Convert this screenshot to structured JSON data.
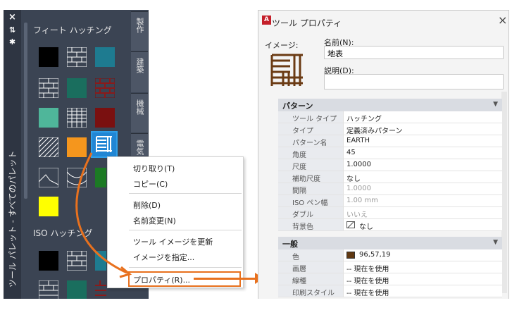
{
  "palette": {
    "close_icon": "×",
    "move_icon": "⇅",
    "settings_icon": "✱",
    "title": "ツール パレット - すべてのパレット",
    "section1": "フィート ハッチング",
    "section2": "ISO ハッチング",
    "tabs": [
      "製作",
      "建築",
      "機械",
      "電気"
    ],
    "swatch_colors": {
      "black": "#000000",
      "teal": "#1e7b90",
      "darkteal": "#1a6e5e",
      "green": "#4fb69a",
      "orange": "#f5961d",
      "maroon": "#7a1010",
      "yellow": "#ffff00",
      "brightgreen": "#1c7a24"
    }
  },
  "menu": {
    "cut": "切り取り(T)",
    "copy": "コピー(C)",
    "delete": "削除(D)",
    "rename": "名前変更(N)",
    "update_image": "ツール イメージを更新",
    "specify_image": "イメージを指定...",
    "properties": "プロパティ(R)..."
  },
  "dialog": {
    "title": "ツール プロパティ",
    "image_label": "イメージ:",
    "name_label": "名前(N):",
    "name_value": "地表",
    "desc_label": "説明(D):",
    "desc_value": "",
    "accent": "#e8711e"
  },
  "props": {
    "pattern_header": "パターン",
    "pattern_rows": [
      {
        "k": "ツール タイプ",
        "v": "ハッチング"
      },
      {
        "k": "タイプ",
        "v": "定義済みパターン"
      },
      {
        "k": "パターン名",
        "v": "EARTH"
      },
      {
        "k": "角度",
        "v": "45"
      },
      {
        "k": "尺度",
        "v": "1.0000"
      },
      {
        "k": "補助尺度",
        "v": "なし"
      },
      {
        "k": "間隔",
        "v": "1.0000"
      },
      {
        "k": "ISO ペン幅",
        "v": "1.00 mm"
      },
      {
        "k": "ダブル",
        "v": "いいえ"
      },
      {
        "k": "背景色",
        "v": "なし"
      }
    ],
    "general_header": "一般",
    "general_rows": [
      {
        "k": "色",
        "v": "96,57,19"
      },
      {
        "k": "画層",
        "v": "-- 現在を使用"
      },
      {
        "k": "線種",
        "v": "-- 現在を使用"
      },
      {
        "k": "印刷スタイル",
        "v": "-- 現在を使用"
      }
    ],
    "color_swatch": "#603913"
  }
}
